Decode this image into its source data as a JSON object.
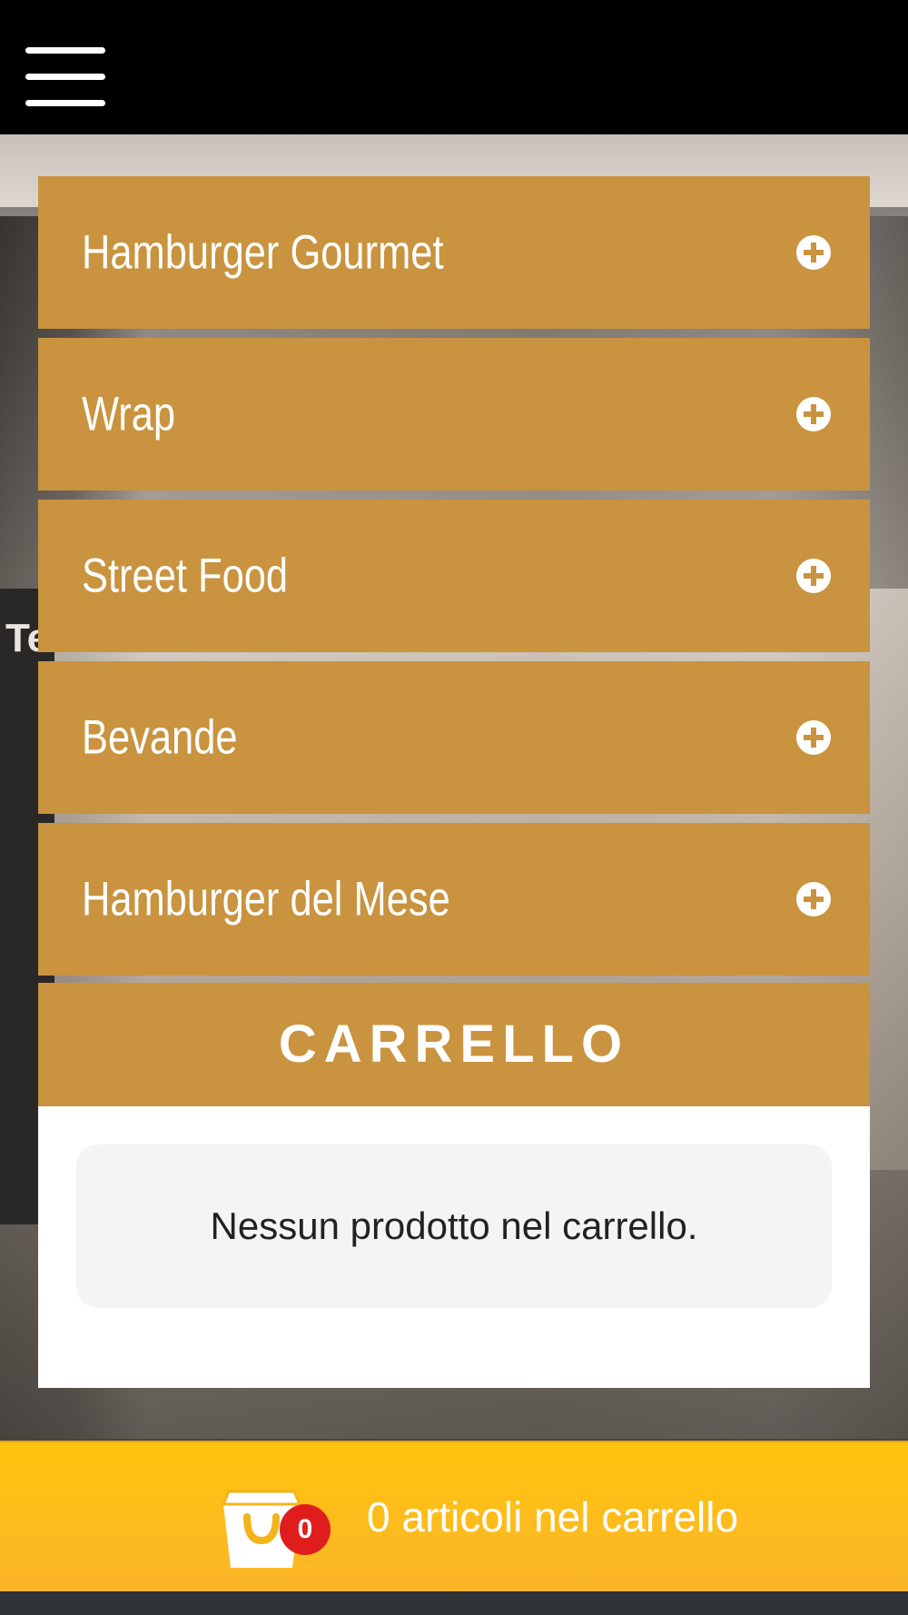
{
  "header": {
    "menu_icon": "hamburger-menu-icon"
  },
  "background": {
    "sign_text": "Te"
  },
  "categories": [
    {
      "label": "Hamburger Gourmet",
      "icon": "plus-circle-icon"
    },
    {
      "label": "Wrap",
      "icon": "plus-circle-icon"
    },
    {
      "label": "Street Food",
      "icon": "plus-circle-icon"
    },
    {
      "label": "Bevande",
      "icon": "plus-circle-icon"
    },
    {
      "label": "Hamburger del Mese",
      "icon": "plus-circle-icon"
    }
  ],
  "cart": {
    "title": "CARRELLO",
    "empty_message": "Nessun prodotto nel carrello."
  },
  "bottom_bar": {
    "count_badge": "0",
    "label": "0 articoli nel carrello",
    "icon": "shopping-bag-icon"
  },
  "colors": {
    "accent": "#c9933f",
    "bottom_bar": "#ffc40c",
    "badge": "#e01d1d",
    "header": "#000000"
  }
}
